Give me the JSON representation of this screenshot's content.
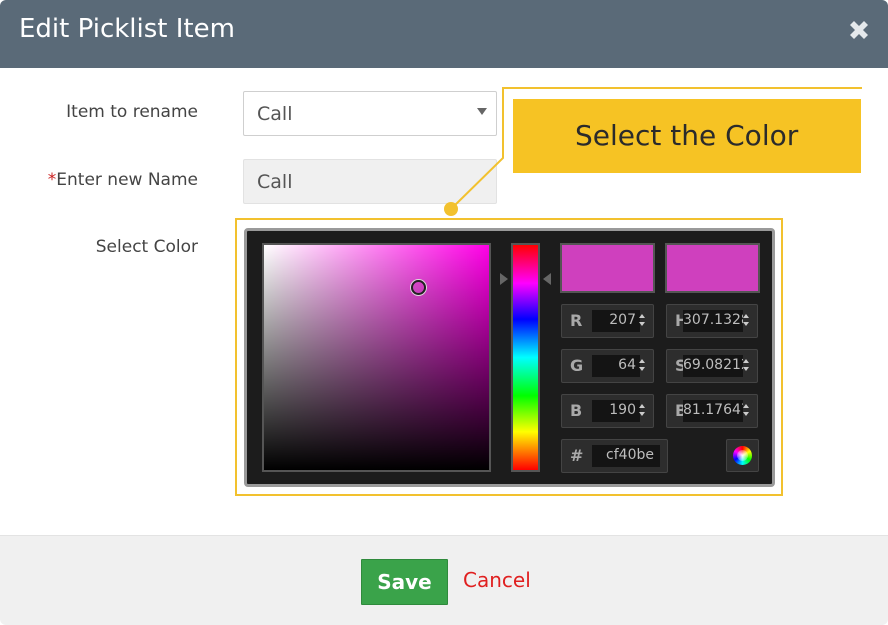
{
  "dialog": {
    "title": "Edit Picklist Item",
    "close_icon": "close-icon"
  },
  "form": {
    "item_label": "Item to rename",
    "item_value": "Call",
    "name_required_mark": "*",
    "name_label": "Enter new Name",
    "name_value": "Call",
    "color_label": "Select Color"
  },
  "callout": {
    "text": "Select the Color",
    "color": "#f6c324"
  },
  "color_picker": {
    "new_color": "#cf40be",
    "current_color": "#cf40be",
    "hue_base": "#ff00e6",
    "fields": {
      "r_letter": "R",
      "r": "207",
      "g_letter": "G",
      "g": "64",
      "b_letter": "B",
      "b": "190",
      "h_letter": "H",
      "h": "307.1328",
      "s_letter": "S",
      "s": "69.08212",
      "br_letter": "B",
      "br": "81.17647",
      "hex_letter": "#",
      "hex": "cf40be"
    },
    "wheel_icon": "color-wheel-icon"
  },
  "footer": {
    "save_label": "Save",
    "cancel_label": "Cancel",
    "save_color": "#3aa34a",
    "cancel_color": "#e02020"
  }
}
